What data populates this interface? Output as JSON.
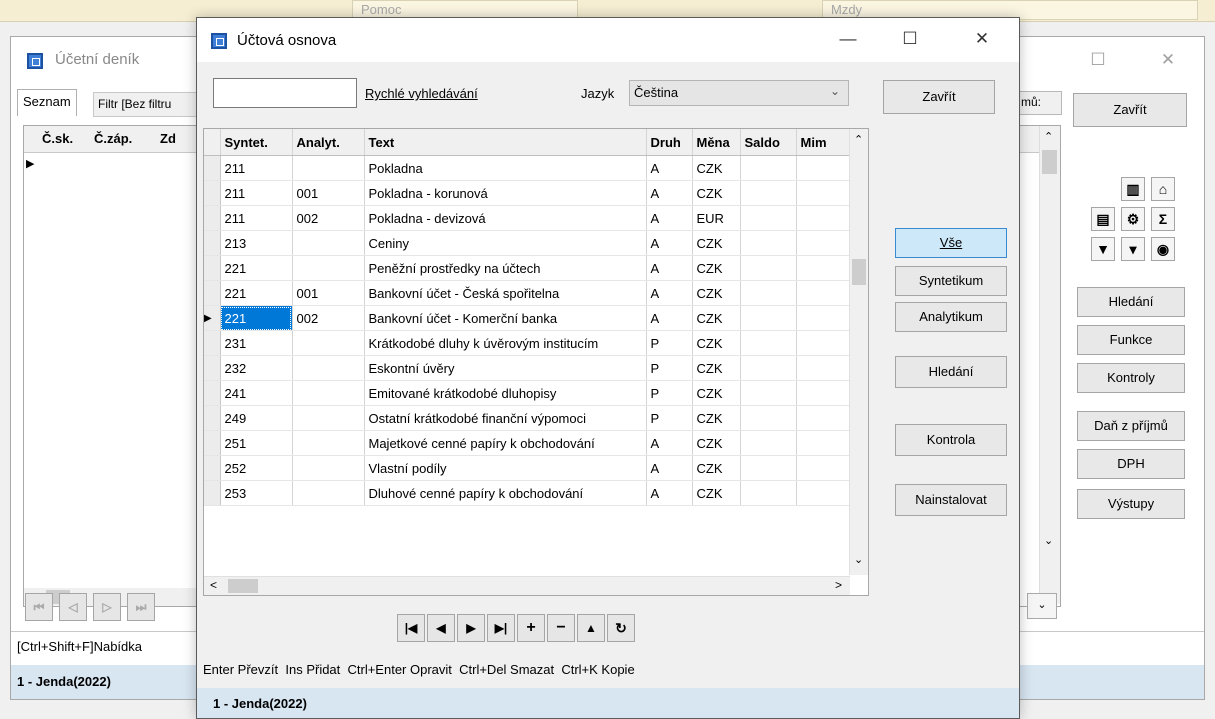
{
  "top_strip": {
    "tab1": "Pomoc",
    "tab2": "Mzdy"
  },
  "bg_window": {
    "title": "Účetní deník",
    "tab_list": "Seznam",
    "tab_filter": "Filtr [Bez filtru",
    "columns": [
      "Č.sk.",
      "Č.záp.",
      "Zd"
    ],
    "label_right": "mů:",
    "close_label": "Zavřít",
    "side_buttons": [
      "Hledání",
      "Funkce",
      "Kontroly",
      "Daň z příjmů",
      "DPH",
      "Výstupy"
    ],
    "help_text": "[Ctrl+Shift+F]Nabídka",
    "status": "1 - Jenda(2022)"
  },
  "dialog": {
    "title": "Účtová osnova",
    "search_value": "",
    "search_label": "Rychlé vyhledávání",
    "lang_label": "Jazyk",
    "lang_value": "Čeština",
    "close_label": "Zavřít",
    "columns": [
      "Syntet.",
      "Analyt.",
      "Text",
      "Druh",
      "Měna",
      "Saldo",
      "Mim"
    ],
    "rows": [
      {
        "syn": "211",
        "ana": "",
        "text": "Pokladna",
        "druh": "A",
        "mena": "CZK"
      },
      {
        "syn": "211",
        "ana": "001",
        "text": "Pokladna - korunová",
        "druh": "A",
        "mena": "CZK"
      },
      {
        "syn": "211",
        "ana": "002",
        "text": "Pokladna - devizová",
        "druh": "A",
        "mena": "EUR"
      },
      {
        "syn": "213",
        "ana": "",
        "text": "Ceniny",
        "druh": "A",
        "mena": "CZK"
      },
      {
        "syn": "221",
        "ana": "",
        "text": "Peněžní prostředky na účtech",
        "druh": "A",
        "mena": "CZK"
      },
      {
        "syn": "221",
        "ana": "001",
        "text": "Bankovní účet - Česká spořitelna",
        "druh": "A",
        "mena": "CZK"
      },
      {
        "syn": "221",
        "ana": "002",
        "text": "Bankovní účet - Komerční banka",
        "druh": "A",
        "mena": "CZK"
      },
      {
        "syn": "231",
        "ana": "",
        "text": "Krátkodobé dluhy k úvěrovým institucím",
        "druh": "P",
        "mena": "CZK"
      },
      {
        "syn": "232",
        "ana": "",
        "text": "Eskontní úvěry",
        "druh": "P",
        "mena": "CZK"
      },
      {
        "syn": "241",
        "ana": "",
        "text": "Emitované krátkodobé dluhopisy",
        "druh": "P",
        "mena": "CZK"
      },
      {
        "syn": "249",
        "ana": "",
        "text": "Ostatní krátkodobé finanční výpomoci",
        "druh": "P",
        "mena": "CZK"
      },
      {
        "syn": "251",
        "ana": "",
        "text": "Majetkové cenné papíry k obchodování",
        "druh": "A",
        "mena": "CZK"
      },
      {
        "syn": "252",
        "ana": "",
        "text": "Vlastní podíly",
        "druh": "A",
        "mena": "CZK"
      },
      {
        "syn": "253",
        "ana": "",
        "text": "Dluhové cenné papíry k obchodování",
        "druh": "A",
        "mena": "CZK"
      }
    ],
    "right_buttons": {
      "all": "Vše",
      "synthetic": "Syntetikum",
      "analytic": "Analytikum",
      "search": "Hledání",
      "check": "Kontrola",
      "install": "Nainstalovat"
    },
    "shortcuts": "Enter Převzít  Ins Přidat  Ctrl+Enter Opravit  Ctrl+Del Smazat  Ctrl+K Kopie",
    "status": "1 - Jenda(2022)"
  }
}
